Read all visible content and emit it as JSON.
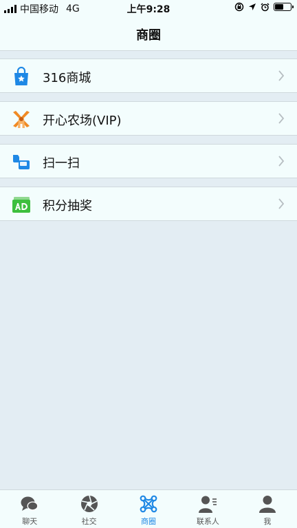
{
  "status_bar": {
    "carrier": "中国移动",
    "network": "4G",
    "time": "上午9:28",
    "battery_level": 0.55
  },
  "header": {
    "title": "商圈"
  },
  "menu": {
    "items": [
      {
        "label": "316商城",
        "icon": "shopping-bag-icon"
      },
      {
        "label": "开心农场(VIP)",
        "icon": "windmill-icon"
      },
      {
        "label": "扫一扫",
        "icon": "scan-icon"
      },
      {
        "label": "积分抽奖",
        "icon": "ad-ticket-icon"
      }
    ]
  },
  "tab_bar": {
    "active": 2,
    "tabs": [
      {
        "label": "聊天",
        "icon": "chat-bubble-icon"
      },
      {
        "label": "社交",
        "icon": "aperture-icon"
      },
      {
        "label": "商圈",
        "icon": "network-icon"
      },
      {
        "label": "联系人",
        "icon": "contacts-icon"
      },
      {
        "label": "我",
        "icon": "person-icon"
      }
    ]
  },
  "colors": {
    "accent": "#1e88e5",
    "orange": "#f08a24",
    "green": "#3dbf3d",
    "background": "#e3edf3",
    "surface": "#f3fdfd"
  }
}
